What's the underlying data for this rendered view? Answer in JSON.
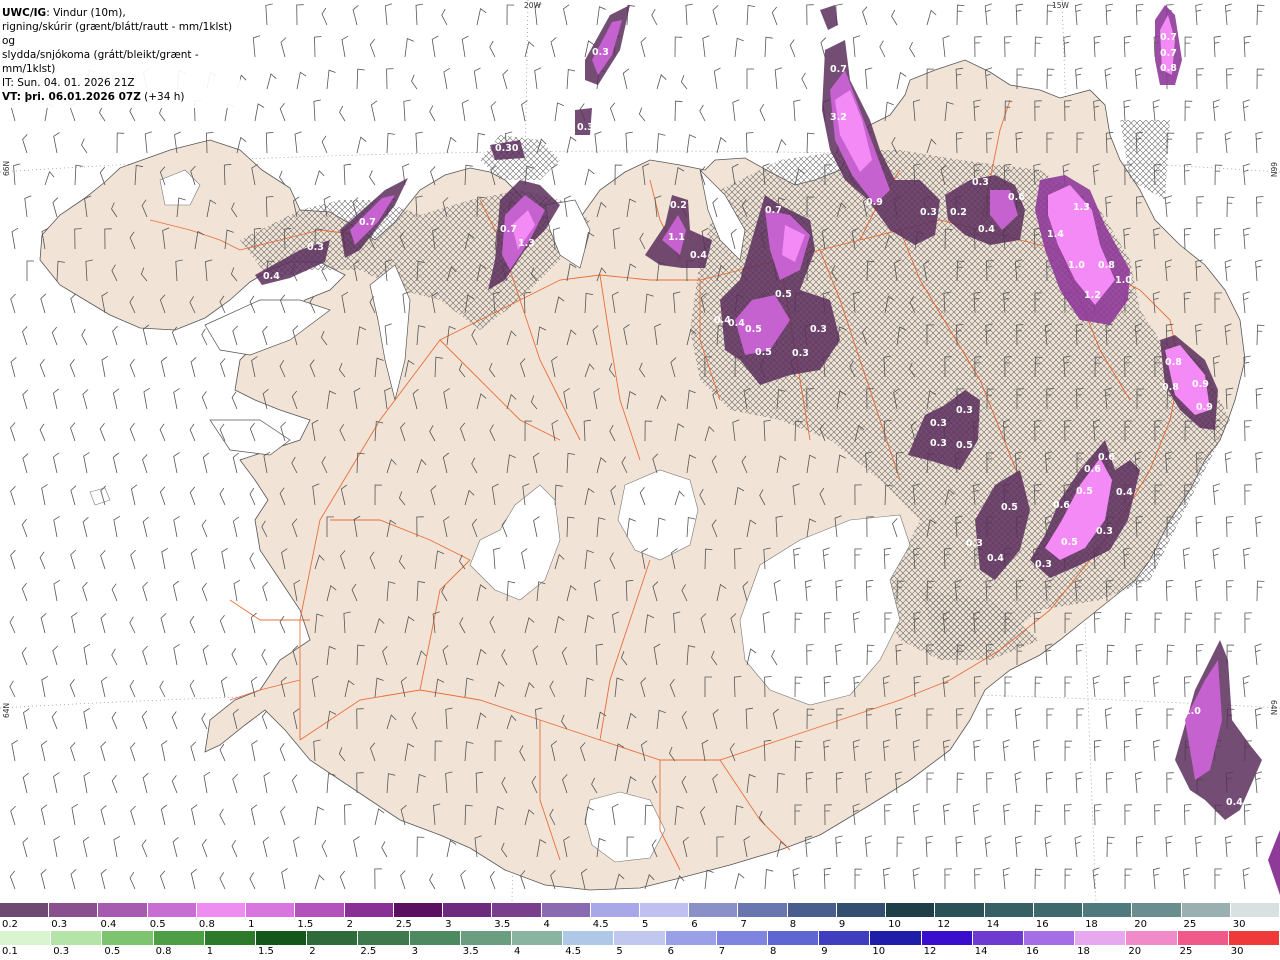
{
  "header": {
    "product": "UWC/IG",
    "line1": ": Vindur (10m),",
    "line2": "rigning/skúrir (grænt/blátt/rautt - mm/1klst) og",
    "line3": "slydda/snjókoma (grátt/bleikt/grænt - mm/1klst)",
    "init_time": "IT: Sun. 04. 01. 2026 21Z",
    "valid_time": "VT: þri. 06.01.2026 07Z",
    "lead": " (+34 h)"
  },
  "grid_labels": {
    "lon_20w": "20W",
    "lon_15w": "15W",
    "lat_66n_left": "66N",
    "lat_66n_right": "66N",
    "lat_64n_left": "64N",
    "lat_64n_right": "64N"
  },
  "colors": {
    "land": "#f1e4d6",
    "road": "#e8622a",
    "glacier": "#ffffff",
    "coast": "#555555",
    "barb": "#555555",
    "precip_dark": "#5a2e5c",
    "precip_mid": "#8e3a99",
    "precip_light": "#d868e0",
    "precip_bright": "#f38af5"
  },
  "precip_labels": [
    "0.4",
    "0.3",
    "0.7",
    "0.30",
    "0.7",
    "1.3",
    "0.3",
    "0.3",
    "0.2",
    "1.1",
    "0.4",
    "0.7",
    "0.5",
    "0.5",
    "0.5",
    "0.3",
    "0.3",
    "0.4",
    "0.4",
    "0.9",
    "0.3",
    "0.2",
    "0.3",
    "0.4",
    "0.6",
    "1.3",
    "1.4",
    "1.0",
    "1.2",
    "0.8",
    "1.0",
    "3.2",
    "0.7",
    "0.8",
    "0.8",
    "0.9",
    "0.9",
    "0.3",
    "0.3",
    "0.3",
    "0.5",
    "0.6",
    "0.6",
    "0.5",
    "0.4",
    "0.5",
    "0.6",
    "0.3",
    "0.5",
    "0.4",
    "0.3",
    "0.3",
    "2.0",
    "0.4",
    "0.7",
    "0.7",
    "0.8"
  ],
  "legend_snow": {
    "labels": [
      "0.2",
      "0.3",
      "0.4",
      "0.5",
      "0.8",
      "1",
      "1.5",
      "2",
      "2.5",
      "3",
      "3.5",
      "4",
      "4.5",
      "5",
      "6",
      "7",
      "8",
      "9",
      "10",
      "12",
      "14",
      "16",
      "18",
      "20",
      "25",
      "30"
    ],
    "colors": [
      "#6e4a72",
      "#8a4f8e",
      "#a65ab0",
      "#c86ed2",
      "#ee8cf2",
      "#d875de",
      "#b452bd",
      "#8a2f95",
      "#5a0f60",
      "#6e2a7c",
      "#7a3f8c",
      "#8a6ab0",
      "#a8a8e8",
      "#c0c0f0",
      "#8a90c8",
      "#6a76b0",
      "#4a5e8e",
      "#334e6e",
      "#1e3e48",
      "#2a5058",
      "#366064",
      "#3e6a6e",
      "#4e7a7e",
      "#6a8e90",
      "#9ab0b0",
      "#d8e0e0"
    ]
  },
  "legend_rain": {
    "labels": [
      "0.1",
      "0.3",
      "0.5",
      "0.8",
      "1",
      "1.5",
      "2",
      "2.5",
      "3",
      "3.5",
      "4",
      "4.5",
      "5",
      "6",
      "7",
      "8",
      "9",
      "10",
      "12",
      "14",
      "16",
      "18",
      "20",
      "25",
      "30"
    ],
    "colors": [
      "#d8f5d0",
      "#b4e4a8",
      "#7ec46e",
      "#4e9e46",
      "#2c7a2a",
      "#15571a",
      "#2e6a3a",
      "#3e7a4c",
      "#4e8a60",
      "#6a9e7e",
      "#8ab4a0",
      "#b0c8e8",
      "#c0c8f0",
      "#9aa0e8",
      "#7e84e0",
      "#5e66d2",
      "#3e3ebe",
      "#1e1ea8",
      "#3a0ecc",
      "#6e3ad0",
      "#a46ee6",
      "#e8a8f0",
      "#f08ac8",
      "#f05a8a",
      "#f03a3a"
    ]
  }
}
